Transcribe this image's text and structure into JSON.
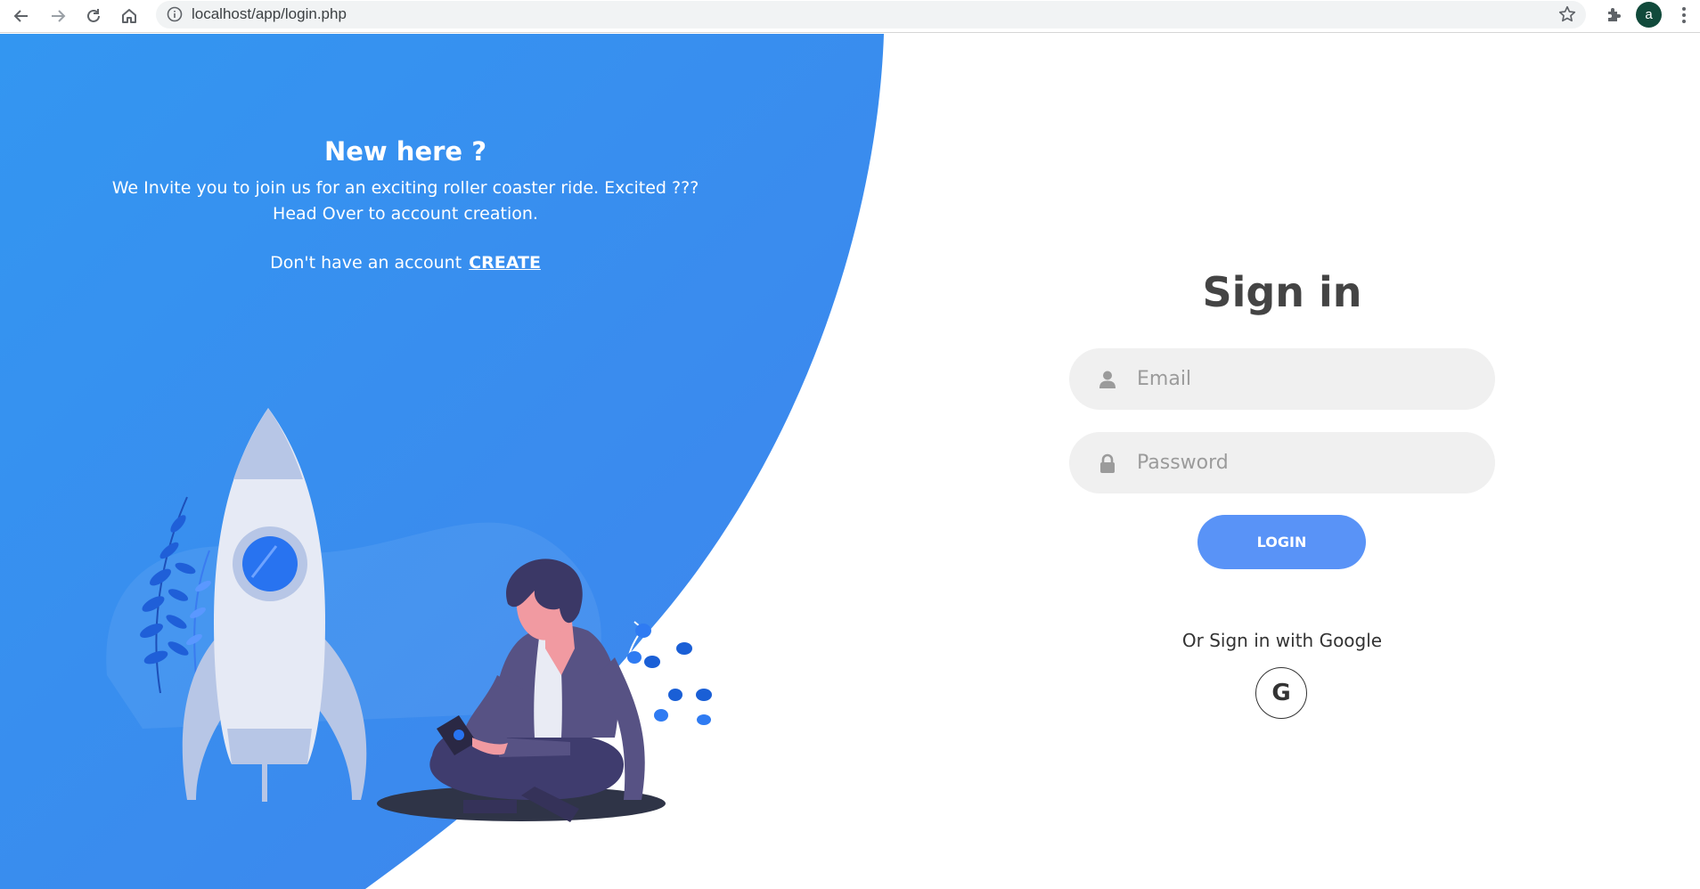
{
  "browser": {
    "url": "localhost/app/login.php",
    "avatar_letter": "a"
  },
  "left_panel": {
    "title": "New here ?",
    "description_line1": "We Invite you to join us for an exciting roller coaster ride. Excited ???",
    "description_line2": "Head Over to account creation.",
    "account_prompt": "Don't have an account",
    "create_link": "CREATE"
  },
  "signin": {
    "title": "Sign in",
    "email_placeholder": "Email",
    "password_placeholder": "Password",
    "login_label": "LOGIN",
    "google_text": "Or Sign in with Google",
    "google_letter": "G"
  },
  "colors": {
    "blue_panel": "#3b8df0",
    "login_button": "#5993f7",
    "field_bg": "#f0f0f0"
  }
}
